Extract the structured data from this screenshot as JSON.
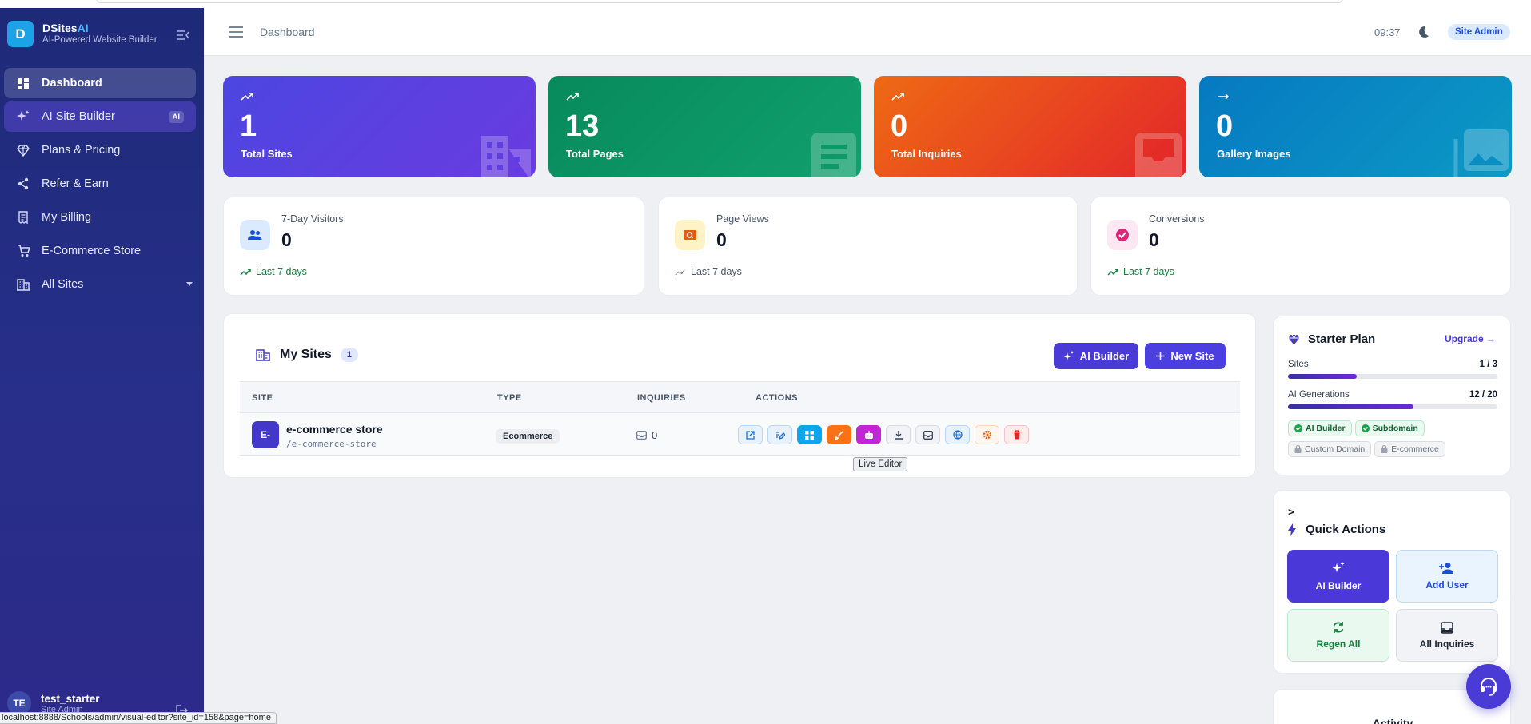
{
  "sidebar": {
    "brand_name": "DSites",
    "brand_ai": "AI",
    "brand_sub": "AI-Powered Website Builder",
    "logo_letter": "D",
    "items": [
      {
        "label": "Dashboard",
        "icon": "dashboard-icon"
      },
      {
        "label": "AI Site Builder",
        "icon": "sparkle-icon",
        "badge": "AI"
      },
      {
        "label": "Plans & Pricing",
        "icon": "gem-icon"
      },
      {
        "label": "Refer & Earn",
        "icon": "share-icon"
      },
      {
        "label": "My Billing",
        "icon": "receipt-icon"
      },
      {
        "label": "E-Commerce Store",
        "icon": "cart-icon"
      },
      {
        "label": "All Sites",
        "icon": "building-icon"
      }
    ],
    "user": {
      "initials": "TE",
      "name": "test_starter",
      "role": "Site Admin"
    }
  },
  "topbar": {
    "breadcrumb": "Dashboard",
    "time": "09:37",
    "role_badge": "Site Admin"
  },
  "stats": [
    {
      "value": "1",
      "label": "Total Sites",
      "color": "#4c46e0"
    },
    {
      "value": "13",
      "label": "Total Pages",
      "color": "#078a5c"
    },
    {
      "value": "0",
      "label": "Total Inquiries",
      "color": "#e84a1f"
    },
    {
      "value": "0",
      "label": "Gallery Images",
      "color": "#0679c2"
    }
  ],
  "metrics": [
    {
      "title": "7-Day Visitors",
      "value": "0",
      "foot": "Last 7 days"
    },
    {
      "title": "Page Views",
      "value": "0",
      "foot": "Last 7 days"
    },
    {
      "title": "Conversions",
      "value": "0",
      "foot": "Last 7 days"
    }
  ],
  "sites": {
    "title": "My Sites",
    "count": "1",
    "ai_builder_label": "AI Builder",
    "new_site_label": "New Site",
    "columns": [
      "SITE",
      "TYPE",
      "INQUIRIES",
      "ACTIONS"
    ],
    "rows": [
      {
        "avatar": "E-",
        "name": "e-commerce store",
        "slug": "/e-commerce-store",
        "type": "Ecommerce",
        "inquiries": "0"
      }
    ],
    "tooltip": "Live Editor"
  },
  "plan": {
    "title": "Starter Plan",
    "upgrade": "Upgrade →",
    "rows": [
      {
        "label": "Sites",
        "value": "1 / 3",
        "fraction": 0.33
      },
      {
        "label": "AI Generations",
        "value": "12 / 20",
        "fraction": 0.6
      }
    ],
    "features": [
      {
        "label": "AI Builder",
        "enabled": true
      },
      {
        "label": "Subdomain",
        "enabled": true
      },
      {
        "label": "Custom Domain",
        "enabled": false
      },
      {
        "label": "E-commerce",
        "enabled": false
      }
    ]
  },
  "quick_actions": {
    "prefix": ">",
    "title": "Quick Actions",
    "items": [
      {
        "label": "AI Builder"
      },
      {
        "label": "Add User"
      },
      {
        "label": "Regen All"
      },
      {
        "label": "All Inquiries"
      }
    ]
  },
  "activity": {
    "title": "Activity"
  },
  "status_url": "localhost:8888/Schools/admin/visual-editor?site_id=158&page=home"
}
